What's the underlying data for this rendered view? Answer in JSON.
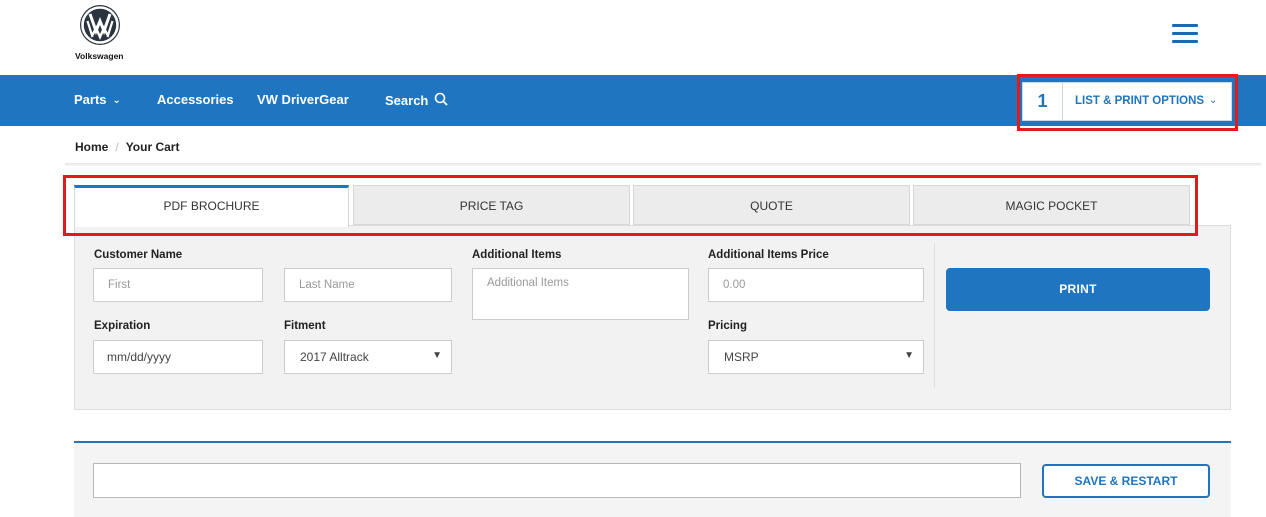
{
  "brand": {
    "name": "Volkswagen",
    "accent": "#1f75bf",
    "highlight": "#e11a1a"
  },
  "header": {
    "menu_icon": "hamburger-menu-icon"
  },
  "nav": {
    "parts": "Parts",
    "accessories": "Accessories",
    "drivergear": "VW DriverGear",
    "search": "Search",
    "chevron_icon": "chevron-down-icon",
    "search_icon": "search-icon"
  },
  "list_print": {
    "count": "1",
    "label": "LIST & PRINT OPTIONS"
  },
  "breadcrumb": {
    "home": "Home",
    "separator": "/",
    "current": "Your Cart"
  },
  "tabs": [
    {
      "label": "PDF BROCHURE",
      "active": true
    },
    {
      "label": "PRICE TAG",
      "active": false
    },
    {
      "label": "QUOTE",
      "active": false
    },
    {
      "label": "MAGIC POCKET",
      "active": false
    }
  ],
  "form": {
    "customer_name_label": "Customer Name",
    "first_placeholder": "First",
    "last_placeholder": "Last Name",
    "additional_items_label": "Additional Items",
    "additional_items_placeholder": "Additional Items",
    "additional_price_label": "Additional Items Price",
    "additional_price_placeholder": "0.00",
    "expiration_label": "Expiration",
    "expiration_value": "mm/dd/yyyy",
    "fitment_label": "Fitment",
    "fitment_value": "2017 Alltrack",
    "pricing_label": "Pricing",
    "pricing_value": "MSRP",
    "print_label": "PRINT"
  },
  "bottom": {
    "save_label": "SAVE & RESTART"
  }
}
